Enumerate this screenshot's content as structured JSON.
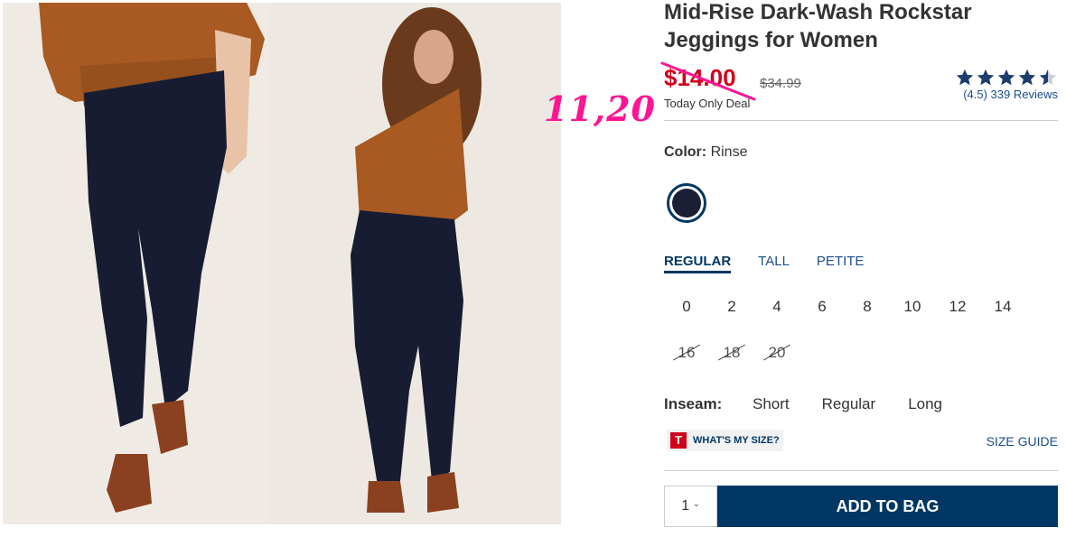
{
  "product": {
    "title": "Mid-Rise Dark-Wash Rockstar Jeggings for Women",
    "price": "$14.00",
    "original_price": "$34.99",
    "deal_text": "Today Only Deal"
  },
  "annotation": "11,20",
  "rating": {
    "stars": 4.5,
    "reviews_text": "(4.5) 339 Reviews",
    "star_color": "#1c3d6e"
  },
  "color": {
    "label": "Color:",
    "value": "Rinse",
    "swatch_color": "#1a1f36"
  },
  "fits": {
    "tabs": [
      "REGULAR",
      "TALL",
      "PETITE"
    ],
    "selected": "REGULAR"
  },
  "sizes": {
    "available": [
      "0",
      "2",
      "4",
      "6",
      "8",
      "10",
      "12",
      "14"
    ],
    "unavailable": [
      "16",
      "18",
      "20"
    ]
  },
  "inseam": {
    "label": "Inseam:",
    "options": [
      "Short",
      "Regular",
      "Long"
    ]
  },
  "whats_my_size": {
    "logo": "T",
    "label": "WHAT'S MY SIZE?"
  },
  "size_guide": "SIZE GUIDE",
  "quantity": "1",
  "add_to_bag": "ADD TO BAG",
  "colors": {
    "primary_navy": "#003764",
    "sale_red": "#d0011b",
    "annotation_pink": "#ff1493"
  }
}
